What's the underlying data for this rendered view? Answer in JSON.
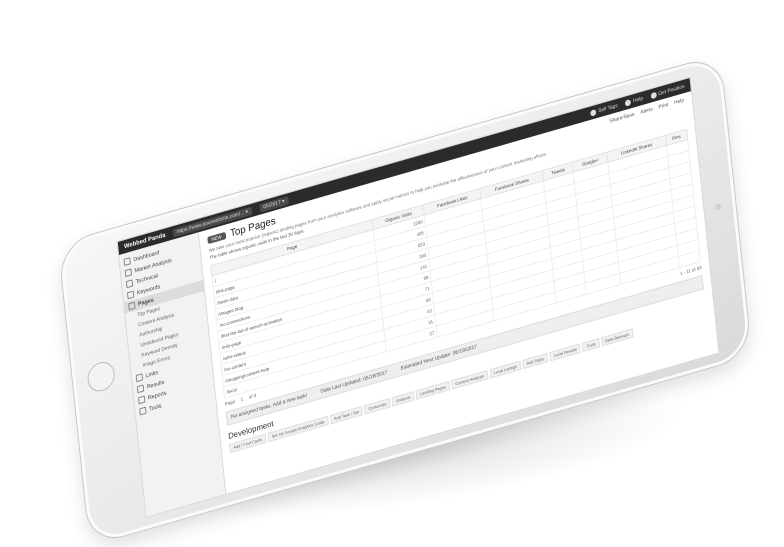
{
  "topbar": {
    "brand": "Webbed Panda",
    "site_select": "https://www.yourwebsite.com/... ▾",
    "month_select": "05/2017 ▾",
    "items": [
      {
        "label": "Sell Tags",
        "icon": "tag-icon"
      },
      {
        "label": "Help",
        "icon": "help-icon"
      },
      {
        "label": "Get Position",
        "icon": "position-icon"
      }
    ]
  },
  "sidebar": {
    "items": [
      {
        "label": "Dashboard",
        "icon": "dashboard-icon"
      },
      {
        "label": "Market Analysis",
        "icon": "chart-icon"
      },
      {
        "label": "Technical",
        "icon": "wrench-icon"
      },
      {
        "label": "Keywords",
        "icon": "key-icon"
      },
      {
        "label": "Pages",
        "icon": "page-icon",
        "active": true
      },
      {
        "label": "Top Pages",
        "sub": true
      },
      {
        "label": "Content Analysis",
        "sub": true
      },
      {
        "label": "Authorship",
        "sub": true
      },
      {
        "label": "Unindexed Pages",
        "sub": true
      },
      {
        "label": "Keyword Density",
        "sub": true
      },
      {
        "label": "Image Errors",
        "sub": true
      },
      {
        "label": "Links",
        "icon": "link-icon"
      },
      {
        "label": "Results",
        "icon": "results-icon"
      },
      {
        "label": "Reports",
        "icon": "report-icon"
      },
      {
        "label": "Tools",
        "icon": "tools-icon"
      }
    ]
  },
  "main": {
    "tag": "NEW",
    "title": "Top Pages",
    "description": "We take your most popular (organic) landing pages from your analytics software and apply social metrics to help you evaluate the effectiveness of your content marketing efforts.",
    "subdesc": "The table shows organic visits in the last 30 days.",
    "right_tools": [
      "Share/Save",
      "Alerts",
      "Print",
      "Help"
    ],
    "table": {
      "headers": [
        "Page",
        "Organic Visits",
        "Facebook Likes",
        "Facebook Shares",
        "Tweets",
        "Google+",
        "LinkedIn Shares",
        "Pins"
      ],
      "rows": [
        {
          "page": "/",
          "visits": "1200"
        },
        {
          "page": "/link-page",
          "visits": "405"
        },
        {
          "page": "/fresh-data",
          "visits": "323"
        },
        {
          "page": "/images-blog",
          "visits": "190"
        },
        {
          "page": "/no-connections",
          "visits": "141"
        },
        {
          "page": "/find-the-list-of-search-activation",
          "visits": "98"
        },
        {
          "page": "/info-page",
          "visits": "71"
        },
        {
          "page": "/with-videos",
          "visits": "66"
        },
        {
          "page": "/no-content",
          "visits": "42"
        },
        {
          "page": "/shopping/content-help",
          "visits": "31"
        },
        {
          "page": "/local",
          "visits": "27"
        }
      ]
    },
    "pager": {
      "page_label": "Page",
      "page_value": "1",
      "of_label": "of 3",
      "range": "1 - 11 of 33"
    },
    "footer": [
      "No assigned tasks. Add a new task!",
      "Data Last Updated: 05/18/2017",
      "Estimated Next Update: 06/19/2017"
    ],
    "dev_title": "Development",
    "dev_tabs": [
      "Add / Find Cards",
      "Set Up Google Analytics Goals",
      "Add Task / Set",
      "Customize",
      "Analysis",
      "Landing Pages",
      "Content Analysis",
      "Local Listings",
      "Add Tasks",
      "Local Results",
      "Tools",
      "Data Backups"
    ]
  }
}
